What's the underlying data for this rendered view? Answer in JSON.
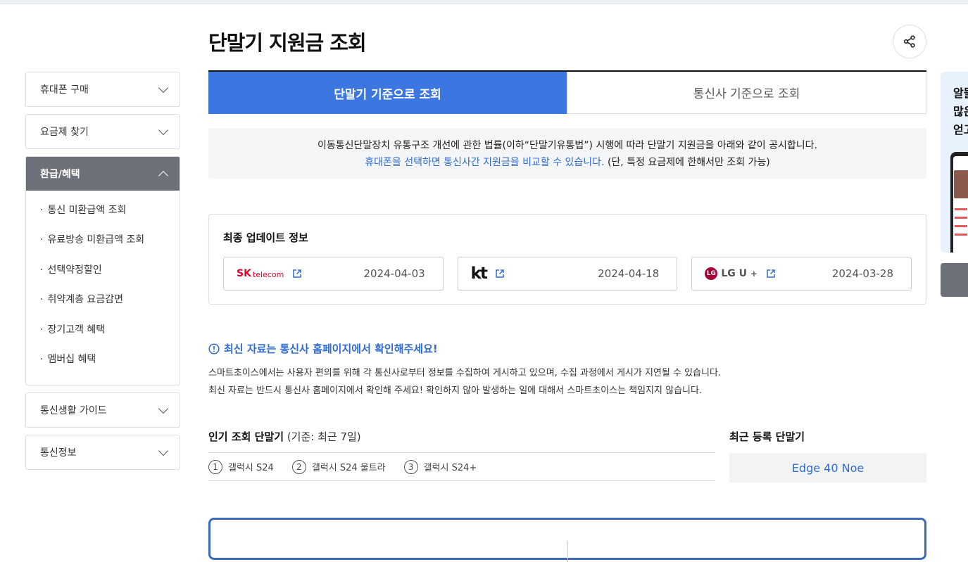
{
  "page": {
    "title": "단말기 지원금 조회"
  },
  "sidebar": {
    "menus": [
      {
        "label": "휴대폰 구매"
      },
      {
        "label": "요금제 찾기"
      },
      {
        "label": "환급/혜택"
      },
      {
        "label": "통신생활 가이드"
      },
      {
        "label": "통신정보"
      }
    ],
    "submenu": [
      {
        "label": "통신 미환급액 조회"
      },
      {
        "label": "유료방송 미환급액 조회"
      },
      {
        "label": "선택약정할인"
      },
      {
        "label": "취약계층 요금감면"
      },
      {
        "label": "장기고객 혜택"
      },
      {
        "label": "멤버십 혜택"
      }
    ]
  },
  "tabs": [
    {
      "label": "단말기 기준으로 조회"
    },
    {
      "label": "통신사 기준으로 조회"
    }
  ],
  "notice": {
    "line1": "이동통신단말장치 유통구조 개선에 관한 법률(이하“단말기유통법”) 시행에 따라 단말기 지원금을 아래와 같이 공시합니다.",
    "line2_link": "휴대폰을 선택하면 통신사간 지원금을 비교할 수 있습니다.",
    "line2_rest": " (단, 특정 요금제에 한해서만 조회 가능)"
  },
  "update": {
    "title": "최종 업데이트 정보",
    "carriers": [
      {
        "logo_main": "SK",
        "logo_sub": "telecom",
        "date": "2024-04-03"
      },
      {
        "logo_main": "kt",
        "date": "2024-04-18"
      },
      {
        "logo_main": "LG U",
        "logo_sup": "+",
        "logo_circle": "LG",
        "date": "2024-03-28"
      }
    ]
  },
  "alert": {
    "title": "최신 자료는 통신사 홈페이지에서 확인해주세요!",
    "line1": "스마트초이스에서는 사용자 편의를 위해 각 통신사로부터 정보를 수집하여 게시하고 있으며, 수집 과정에서 게시가 지연될 수 있습니다.",
    "line2": "최신 자료는 반드시 통신사 홈페이지에서 확인해 주세요! 확인하지 않아 발생하는 일에 대해서 스마트초이스는 책임지지 않습니다."
  },
  "popular": {
    "title": "인기 조회 단말기",
    "subtitle": " (기준: 최근 7일)",
    "items": [
      {
        "num": "1",
        "label": "갤럭시 S24"
      },
      {
        "num": "2",
        "label": "갤럭시 S24 울트라"
      },
      {
        "num": "3",
        "label": "갤럭시 S24+"
      }
    ]
  },
  "recent": {
    "title": "최근 등록 단말기",
    "item": "Edge 40 Noe"
  },
  "banner": {
    "line1": "알뜰",
    "line2": "많은",
    "line3": "얻고"
  },
  "colors": {
    "accent": "#3b76e1",
    "link": "#2f6bd1",
    "sidebar_active": "#6b7079"
  }
}
